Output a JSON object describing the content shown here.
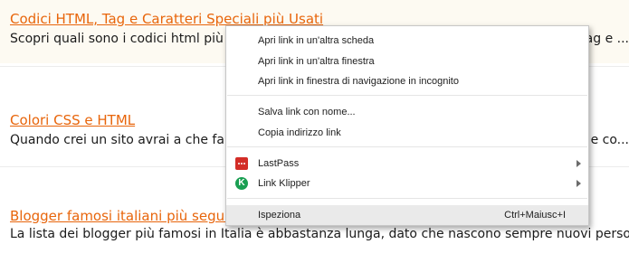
{
  "results": [
    {
      "title": "Codici HTML, Tag e Caratteri Speciali più Usati",
      "desc": "Scopri quali sono i codici html più",
      "desc_tail": "tag e ..."
    },
    {
      "title": "Colori CSS e HTML",
      "desc": "Quando crei un sito avrai a che fa",
      "desc_tail": "e co..."
    },
    {
      "title": "Blogger famosi italiani più segui",
      "desc": "La lista dei blogger più famosi in Italia è abbastanza lunga, dato che nascono sempre nuovi perso"
    }
  ],
  "context_menu": {
    "open_new_tab": "Apri link in un'altra scheda",
    "open_new_window": "Apri link in un'altra finestra",
    "open_incognito": "Apri link in finestra di navigazione in incognito",
    "save_link": "Salva link con nome...",
    "copy_link": "Copia indirizzo link",
    "lastpass": "LastPass",
    "link_klipper": "Link Klipper",
    "inspect": "Ispeziona",
    "inspect_shortcut": "Ctrl+Maiusc+I",
    "lastpass_icon": "lastpass-icon",
    "link_klipper_icon": "link-klipper-icon",
    "link_klipper_icon_glyph": "K"
  },
  "colors": {
    "link": "#e8650b",
    "highlight": "#eaeaea",
    "lastpass": "#d32d27",
    "klipper": "#1a9f52"
  }
}
